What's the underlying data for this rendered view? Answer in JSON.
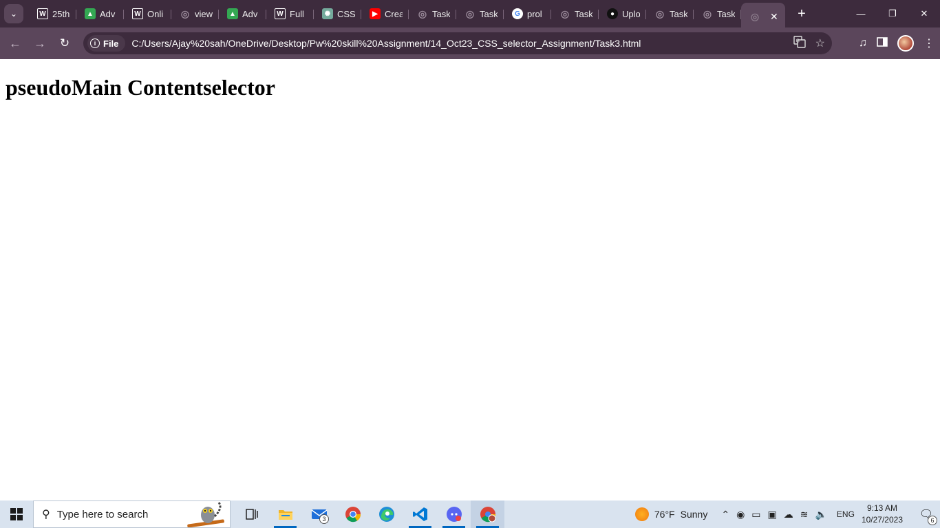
{
  "browser": {
    "tabs": [
      {
        "label": "25th",
        "icon": "wordpress-icon",
        "color": "#3d2b3d"
      },
      {
        "label": "Adv",
        "icon": "google-drive-icon",
        "color": "#34a853"
      },
      {
        "label": "Onli",
        "icon": "wordpress-icon",
        "color": "#3d2b3d"
      },
      {
        "label": "view",
        "icon": "globe-icon",
        "color": "#8a7a8a"
      },
      {
        "label": "Adv",
        "icon": "google-drive-icon",
        "color": "#34a853"
      },
      {
        "label": "Full",
        "icon": "wordpress-icon",
        "color": "#3d2b3d"
      },
      {
        "label": "CSS",
        "icon": "chatgpt-icon",
        "color": "#74aa9c"
      },
      {
        "label": "Crea",
        "icon": "youtube-icon",
        "color": "#ff0000"
      },
      {
        "label": "Task",
        "icon": "globe-icon",
        "color": "#8a7a8a"
      },
      {
        "label": "Task",
        "icon": "globe-icon",
        "color": "#8a7a8a"
      },
      {
        "label": "prol",
        "icon": "google-icon",
        "color": "#4285f4"
      },
      {
        "label": "Task",
        "icon": "globe-icon",
        "color": "#8a7a8a"
      },
      {
        "label": "Uplo",
        "icon": "github-icon",
        "color": "#111111"
      },
      {
        "label": "Task",
        "icon": "globe-icon",
        "color": "#8a7a8a"
      },
      {
        "label": "Task",
        "icon": "globe-icon",
        "color": "#8a7a8a"
      }
    ],
    "active_tab_close": "✕",
    "new_tab": "+",
    "window_controls": {
      "minimize": "—",
      "restore": "❐",
      "close": "✕"
    },
    "site_chip": "File",
    "url": "C:/Users/Ajay%20sah/OneDrive/Desktop/Pw%20skill%20Assignment/14_Oct23_CSS_selector_Assignment/Task3.html"
  },
  "page": {
    "heading": "pseudoMain Contentselector"
  },
  "taskbar": {
    "search_placeholder": "Type here to search",
    "mail_badge": "3",
    "weather_temp": "76°F",
    "weather_desc": "Sunny",
    "language": "ENG",
    "time": "9:13 AM",
    "date": "10/27/2023",
    "notification_count": "6"
  }
}
